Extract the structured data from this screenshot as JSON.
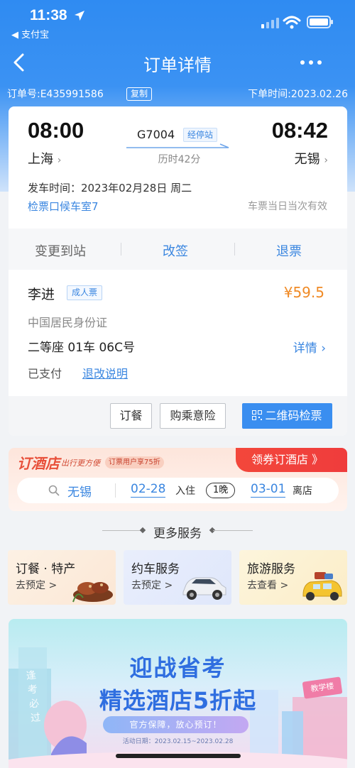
{
  "status_bar": {
    "time": "11:38",
    "back_app": "◀ 支付宝"
  },
  "nav": {
    "title": "订单详情"
  },
  "order": {
    "id": "订单号:E435991586",
    "copy": "复制",
    "placed": "下单时间:2023.02.26"
  },
  "trip": {
    "dep_time": "08:00",
    "arr_time": "08:42",
    "dep_station": "上海",
    "arr_station": "无锡",
    "train_no": "G7004",
    "stops": "经停站",
    "duration": "历时42分",
    "depart_label": "发车时间：2023年02月28日 周二",
    "gate": "检票口候车室7",
    "validity": "车票当日当次有效"
  },
  "actions": {
    "change_station": "变更到站",
    "reschedule": "改签",
    "refund": "退票"
  },
  "passenger": {
    "name": "李进",
    "type": "成人票",
    "price": "¥59.5",
    "id_type": "中国居民身份证",
    "seat": "二等座 01车 06C号",
    "detail": "详情",
    "paid": "已支付",
    "rules": "退改说明"
  },
  "buttons": {
    "meal": "订餐",
    "insurance": "购乘意险",
    "qr": "二维码检票"
  },
  "hotel": {
    "logo": "订酒店",
    "slogan": "出行更方便",
    "promo": "订票用户享75折",
    "coupon": "领券订酒店 》",
    "city": "无锡",
    "checkin": "02-28",
    "checkin_label": "入住",
    "nights": "1晚",
    "checkout": "03-01",
    "checkout_label": "离店"
  },
  "more_services": {
    "title": "更多服务",
    "items": [
      {
        "title": "订餐 · 特产",
        "sub": "去预定 >"
      },
      {
        "title": "约车服务",
        "sub": "去预定 >"
      },
      {
        "title": "旅游服务",
        "sub": "去查看 >"
      }
    ]
  },
  "banner": {
    "line1": "迎战省考",
    "line2": "精选酒店5折起",
    "pill": "官方保障，放心预订！",
    "date": "活动日期：2023.02.15~2023.02.28",
    "tag": "教学楼",
    "side": "逢考必过"
  },
  "colors": {
    "brand_blue": "#3a8ef0",
    "link_blue": "#3a86e0",
    "price_orange": "#f08a25",
    "hotel_red": "#ef3c3c"
  }
}
